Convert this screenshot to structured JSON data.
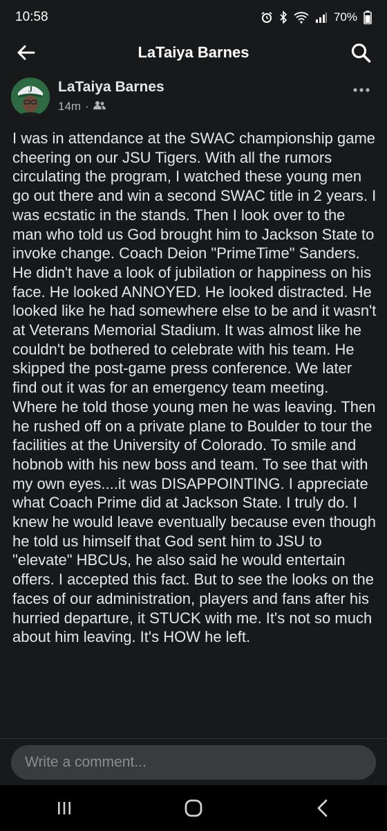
{
  "status_bar": {
    "time": "10:58",
    "battery": "70%",
    "icons": [
      "alarm-icon",
      "bluetooth-icon",
      "wifi-icon",
      "signal-icon",
      "battery-icon"
    ]
  },
  "app_bar": {
    "title": "LaTaiya Barnes",
    "back_icon": "arrow-left-icon",
    "search_icon": "search-icon"
  },
  "post": {
    "author": "LaTaiya Barnes",
    "time_ago": "14m",
    "separator": "·",
    "audience_icon": "friends-icon",
    "more_icon": "more-options-icon",
    "text": "I was in attendance at the SWAC championship game cheering on our JSU Tigers. With all the rumors circulating the program, I watched these young men go out there and win a second SWAC title in 2 years. I was ecstatic in the stands. Then I look over to the man who told us God brought him to Jackson State to invoke change. Coach Deion \"PrimeTime\" Sanders. He didn't have a look of jubilation or happiness on his face. He looked ANNOYED. He looked distracted. He looked like he had somewhere else to be and it wasn't at Veterans Memorial Stadium. It was almost like he couldn't be bothered to celebrate with his team. He skipped the post-game press conference. We later find out it was for an emergency team meeting. Where he told those young men he was leaving. Then he rushed off on a private plane to Boulder to tour the facilities at the University of Colorado. To smile and hobnob with his new boss and team. To see that with my own eyes....it was DISAPPOINTING. I appreciate what Coach Prime did at Jackson State. I truly do. I knew he would leave eventually because even though he told us himself that God sent him to JSU to  \"elevate\" HBCUs,  he also said he would entertain offers. I accepted this fact. But to see the looks on the faces of our administration, players and fans after his hurried departure, it STUCK with me. It's not so much about him leaving. It's HOW he left."
  },
  "comment": {
    "placeholder": "Write a comment..."
  },
  "nav_bar": {
    "icons": [
      "recent-apps-icon",
      "home-icon",
      "back-icon"
    ]
  },
  "colors": {
    "background": "#18191a",
    "text": "#e4e6eb",
    "secondary_text": "#b0b3b8",
    "comment_field": "#3a3b3c",
    "avatar_bg": "#2f6b42"
  }
}
